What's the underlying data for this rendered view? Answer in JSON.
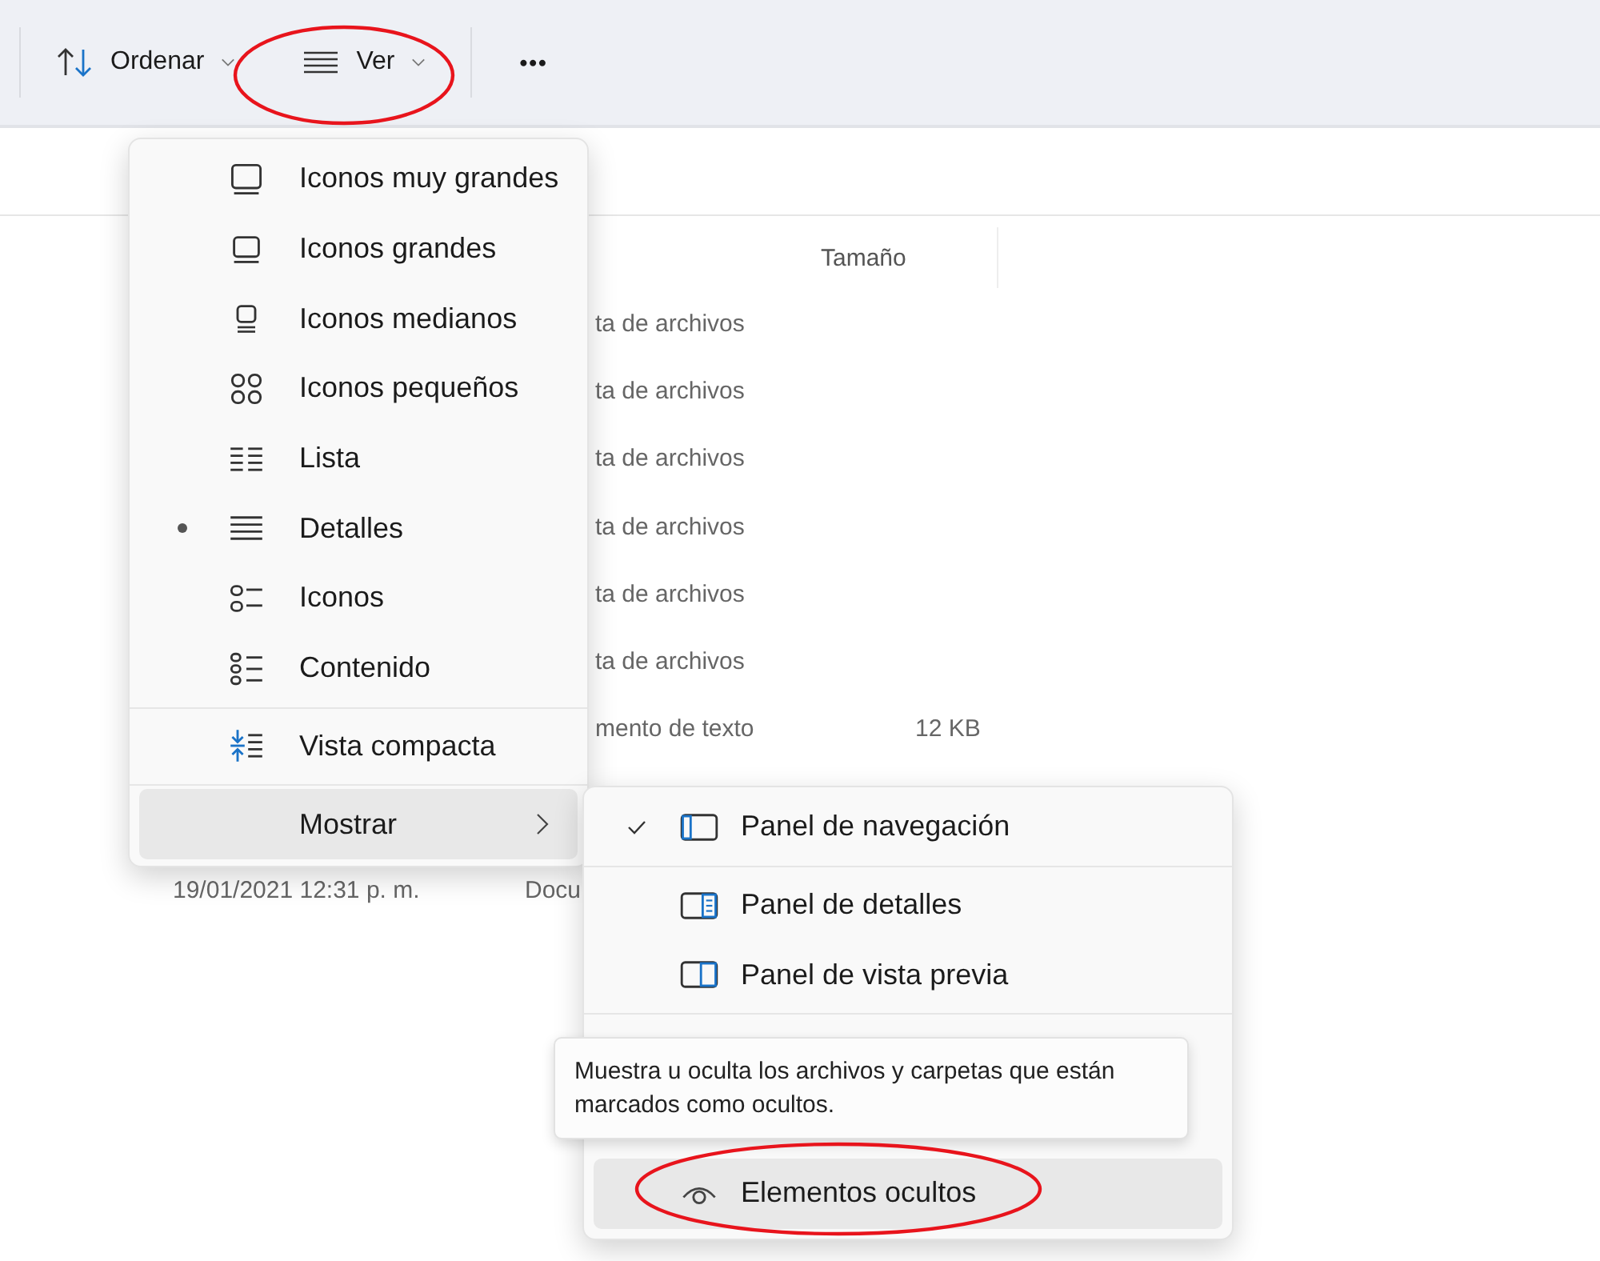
{
  "toolbar": {
    "buttons": [
      {
        "kind": "sort",
        "label": "Ordenar"
      },
      {
        "kind": "view",
        "label": "Ver"
      },
      {
        "kind": "more",
        "label": "•••"
      }
    ]
  },
  "file_list": {
    "columns": [
      "Tamaño"
    ],
    "rows": [
      {
        "type": "ta de archivos"
      },
      {
        "type": "ta de archivos"
      },
      {
        "type": "ta de archivos"
      },
      {
        "type": "ta de archivos"
      },
      {
        "type": "ta de archivos"
      },
      {
        "type": "ta de archivos"
      },
      {
        "type": "mento de texto",
        "size": "12 KB"
      },
      {
        "date": "19/01/2021 12:31 p. m.",
        "type": "Docu"
      }
    ]
  },
  "view_menu": {
    "items": [
      {
        "kind": "layout",
        "label": "Iconos muy grandes",
        "selected": false
      },
      {
        "kind": "layout",
        "label": "Iconos grandes",
        "selected": false
      },
      {
        "kind": "layout",
        "label": "Iconos medianos",
        "selected": false
      },
      {
        "kind": "layout",
        "label": "Iconos pequeños",
        "selected": false
      },
      {
        "kind": "layout",
        "label": "Lista",
        "selected": false
      },
      {
        "kind": "layout",
        "label": "Detalles",
        "selected": true
      },
      {
        "kind": "layout",
        "label": "Iconos",
        "selected": false
      },
      {
        "kind": "layout",
        "label": "Contenido",
        "selected": false
      },
      {
        "kind": "toggle",
        "label": "Vista compacta",
        "checked": false
      },
      {
        "kind": "submenu",
        "label": "Mostrar",
        "expanded": true
      }
    ]
  },
  "show_menu": {
    "items": [
      {
        "label": "Panel de navegación",
        "checked": true,
        "hovered": false
      },
      {
        "label": "Panel de detalles",
        "checked": false,
        "hovered": false
      },
      {
        "label": "Panel de vista previa",
        "checked": false,
        "hovered": false
      },
      {
        "label": "Elementos ocultos",
        "checked": false,
        "hovered": true
      }
    ]
  },
  "tooltip": {
    "text": "Muestra u oculta los archivos y carpetas que están marcados como ocultos."
  }
}
